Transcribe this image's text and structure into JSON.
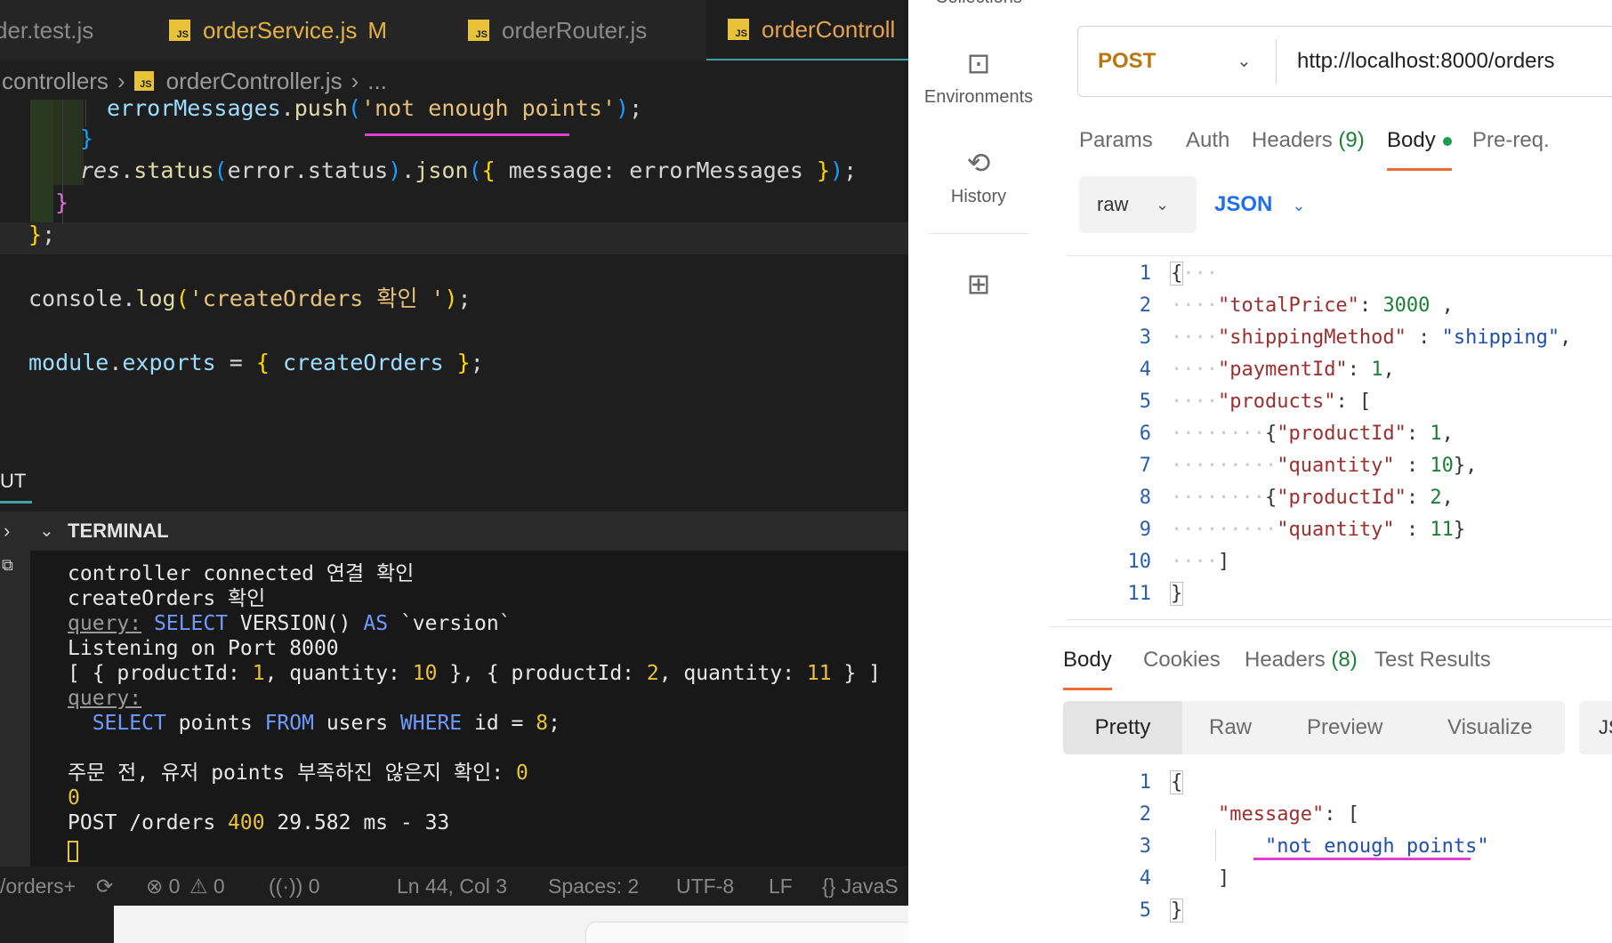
{
  "vscode": {
    "tabs": [
      {
        "label": "der.test.js",
        "icon": false,
        "modified": ""
      },
      {
        "label": "orderService.js",
        "icon": true,
        "modified": "M"
      },
      {
        "label": "orderRouter.js",
        "icon": true,
        "modified": ""
      },
      {
        "label": "orderControll",
        "icon": true,
        "modified": "",
        "active": true
      }
    ],
    "js_badge": "JS",
    "breadcrumb": {
      "folder": "controllers",
      "file": "orderController.js",
      "more": "..."
    },
    "code": {
      "line1": {
        "obj": "errorMessages",
        "method": "push",
        "arg": "'not enough points'",
        "end": ");"
      },
      "line3": {
        "res": "res",
        "status": "status",
        "err": "error",
        "errStatus": "status",
        "json": "json",
        "key": "message:",
        "val": "errorMessages"
      },
      "line6": {
        "obj": "console",
        "method": "log",
        "arg": "'createOrders 확인 '"
      },
      "line8": {
        "obj": "module",
        "prop": "exports",
        "val": "createOrders"
      }
    },
    "panel": {
      "output_tab": "UT",
      "terminal_title": "TERMINAL"
    },
    "terminal": {
      "l1": "controller connected 연결 확인",
      "l2": "createOrders 확인",
      "l3_q": "query:",
      "l3_kw1": "SELECT",
      "l3_mid": "VERSION()",
      "l3_kw2": "AS",
      "l3_end": "`version`",
      "l4": "Listening on Port 8000",
      "l5": {
        "a": "[ { productId: ",
        "n1": "1",
        "b": ", quantity: ",
        "n2": "10",
        "c": " }, { productId: ",
        "n3": "2",
        "d": ", quantity: ",
        "n4": "11",
        "e": " } ]"
      },
      "l6_q": "query:",
      "l7": {
        "kw1": "SELECT",
        "a": " points ",
        "kw2": "FROM",
        "b": " users ",
        "kw3": "WHERE",
        "c": " id = ",
        "n": "8",
        "d": ";"
      },
      "l9": {
        "text": "주문 전, 유저 points 부족하진 않은지 확인: ",
        "n": "0"
      },
      "l10": "0",
      "l11": {
        "a": "POST /orders ",
        "code": "400",
        "b": " 29.582 ms - 33"
      }
    },
    "status": {
      "branch": "/orders+",
      "errors": "0",
      "warnings": "0",
      "ports": "0",
      "position": "Ln 44, Col 3",
      "spaces": "Spaces: 2",
      "encoding": "UTF-8",
      "eol": "LF",
      "language": "{} JavaS"
    }
  },
  "postman": {
    "sidebar": {
      "collections": "Collections",
      "environments": "Environments",
      "history": "History"
    },
    "request": {
      "method": "POST",
      "url": "http://localhost:8000/orders",
      "tabs": {
        "params": "Params",
        "auth": "Auth",
        "headers": "Headers",
        "headers_count": "(9)",
        "body": "Body",
        "prereq": "Pre-req."
      },
      "body_mode": "raw",
      "body_lang": "JSON",
      "lines": [
        "1",
        "2",
        "3",
        "4",
        "5",
        "6",
        "7",
        "8",
        "9",
        "10",
        "11"
      ],
      "json": {
        "k_total": "\"totalPrice\"",
        "v_total": "3000",
        "k_ship": "\"shippingMethod\"",
        "v_ship": "\"shipping\"",
        "k_pay": "\"paymentId\"",
        "v_pay": "1",
        "k_products": "\"products\"",
        "k_pid": "\"productId\"",
        "v_pid1": "1",
        "v_pid2": "2",
        "k_qty": "\"quantity\"",
        "v_qty1": "10",
        "v_qty2": "11"
      }
    },
    "response": {
      "tabs": {
        "body": "Body",
        "cookies": "Cookies",
        "headers": "Headers",
        "headers_count": "(8)",
        "tests": "Test Results"
      },
      "views": {
        "pretty": "Pretty",
        "raw": "Raw",
        "preview": "Preview",
        "visualize": "Visualize",
        "extra": "JS"
      },
      "lines": [
        "1",
        "2",
        "3",
        "4",
        "5"
      ],
      "k_message": "\"message\"",
      "v_message": "\"not enough points\""
    }
  },
  "colors": {
    "accent": "#ef6c39",
    "highlight": "#e040d0",
    "method": "#b9770e",
    "link": "#1f6feb"
  }
}
